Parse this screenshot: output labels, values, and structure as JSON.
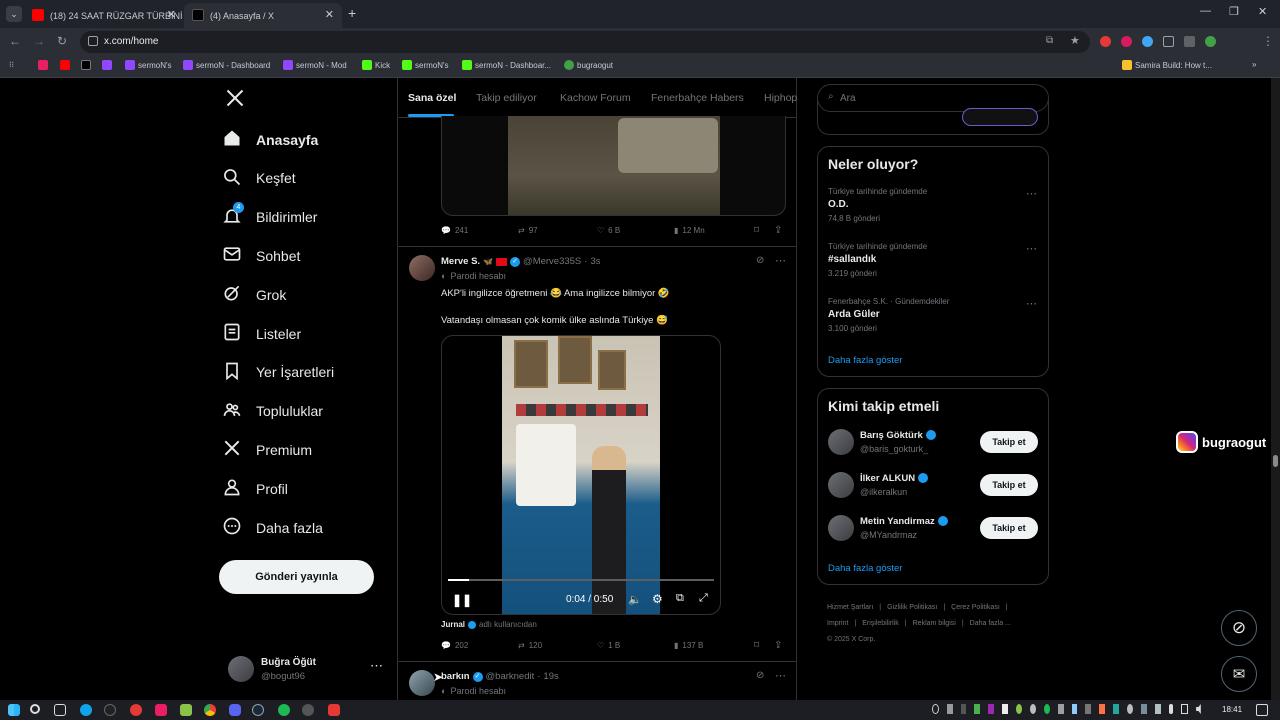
{
  "browser": {
    "tabs": [
      {
        "title": "(18) 24 SAAT RÜZGAR TÜRBİNİ"
      },
      {
        "title": "(4) Anasayfa / X"
      }
    ],
    "url": "x.com/home",
    "bookmarks": [
      "sermoN's",
      "sermoN - Dashboard",
      "sermoN - Mod",
      "Kick",
      "sermoN's",
      "sermoN - Dashboar...",
      "bugraogut",
      "Samira Build: How t..."
    ]
  },
  "sidebar": {
    "items": [
      {
        "label": "Anasayfa",
        "icon": "home-icon"
      },
      {
        "label": "Keşfet",
        "icon": "search-icon"
      },
      {
        "label": "Bildirimler",
        "icon": "bell-icon",
        "badge": "4"
      },
      {
        "label": "Sohbet",
        "icon": "mail-icon"
      },
      {
        "label": "Grok",
        "icon": "grok-icon"
      },
      {
        "label": "Listeler",
        "icon": "list-icon"
      },
      {
        "label": "Yer İşaretleri",
        "icon": "bookmark-icon"
      },
      {
        "label": "Topluluklar",
        "icon": "community-icon"
      },
      {
        "label": "Premium",
        "icon": "x-icon"
      },
      {
        "label": "Profil",
        "icon": "profile-icon"
      },
      {
        "label": "Daha fazla",
        "icon": "more-icon"
      }
    ],
    "post_button": "Gönderi yayınla",
    "account": {
      "name": "Buğra Öğüt",
      "handle": "@bogut96"
    }
  },
  "feed": {
    "tabs": [
      "Sana özel",
      "Takip ediliyor",
      "Kachow Forum",
      "Fenerbahçe Habers",
      "Hiphop"
    ],
    "prev_post_stats": {
      "replies": "241",
      "reposts": "97",
      "likes": "6 B",
      "views": "12 Mn"
    },
    "post": {
      "name": "Merve S.",
      "handle": "@Merve335S",
      "time": "3s",
      "parody_label": "Parodi hesabı",
      "text_line1": "AKP'li ingilizce öğretmeni 😂 Ama ingilizce bilmiyor 🤣",
      "text_line2": "Vatandaşı olmasan çok komik ülke aslında Türkiye 😅",
      "video_time": "0:04 / 0:50",
      "video_progress": 0.08,
      "source_name": "Jurnal",
      "source_suffix": "adlı kullanıcıdan",
      "stats": {
        "replies": "202",
        "reposts": "120",
        "likes": "1 B",
        "views": "137 B"
      }
    },
    "next_post": {
      "name": "barkın",
      "handle": "@barknedit",
      "time": "19s",
      "parody_label": "Parodi hesabı"
    }
  },
  "right": {
    "search_placeholder": "Ara",
    "trends_title": "Neler oluyor?",
    "trends": [
      {
        "context": "Türkiye tarihinde gündemde",
        "topic": "O.D.",
        "count": "74,8 B gönderi"
      },
      {
        "context": "Türkiye tarihinde gündemde",
        "topic": "#sallandık",
        "count": "3.219 gönderi"
      },
      {
        "context": "Fenerbahçe S.K. · Gündemdekiler",
        "topic": "Arda Güler",
        "count": "3.100 gönderi"
      }
    ],
    "show_more": "Daha fazla göster",
    "follow_title": "Kimi takip etmeli",
    "follow": [
      {
        "name": "Barış Göktürk",
        "handle": "@baris_gokturk_",
        "button": "Takip et"
      },
      {
        "name": "İlker ALKUN",
        "handle": "@ilkeralkun",
        "button": "Takip et"
      },
      {
        "name": "Metin Yandirmaz",
        "handle": "@MYandrmaz",
        "button": "Takip et"
      }
    ],
    "follow_more": "Daha fazla göster",
    "footer_line1": [
      "Hizmet Şartları",
      "Gizlilik Politikası",
      "Çerez Politikası"
    ],
    "footer_line2": [
      "Imprint",
      "Erişilebilirlik",
      "Reklam bilgisi",
      "Daha fazla ..."
    ],
    "copyright": "© 2025 X Corp."
  },
  "overlay": {
    "instagram": "bugraogut"
  },
  "taskbar": {
    "clock": "18:41"
  },
  "colors": {
    "accent": "#1d9bf0",
    "verified": "#1d9bf0",
    "bg": "#000000"
  }
}
